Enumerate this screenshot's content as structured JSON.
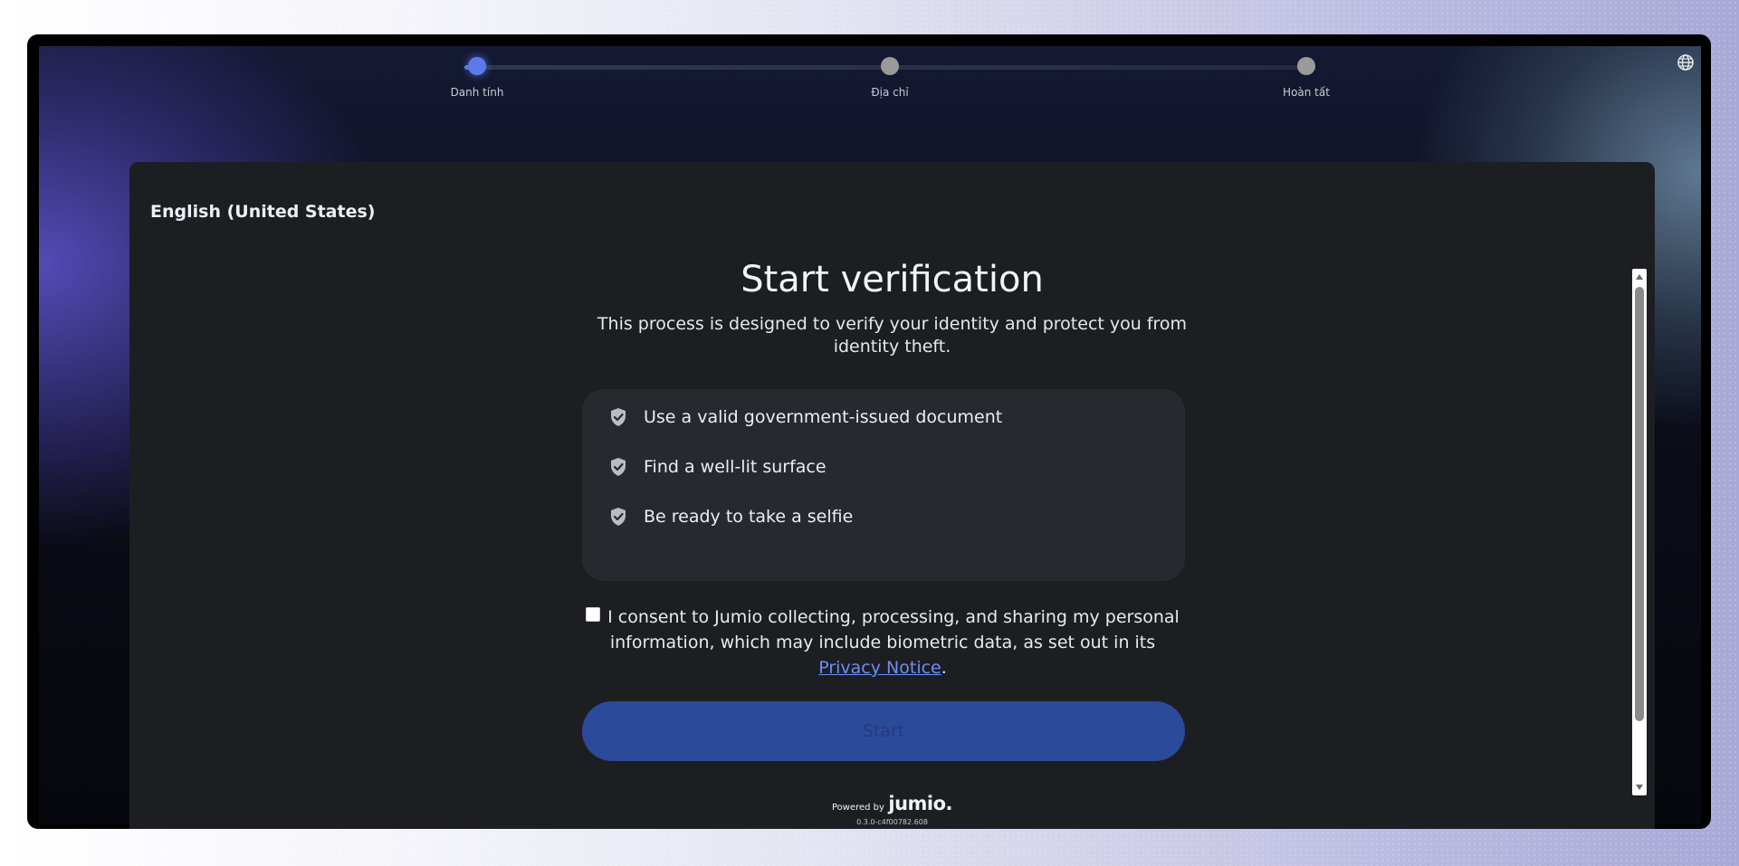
{
  "progress": {
    "steps": [
      {
        "label": "Danh tính",
        "active": true
      },
      {
        "label": "Địa chỉ",
        "active": false
      },
      {
        "label": "Hoàn tất",
        "active": false
      }
    ]
  },
  "language": {
    "selected": "English (United States)"
  },
  "main": {
    "title": "Start verification",
    "subtitle": "This process is designed to verify your identity and protect you from identity theft."
  },
  "checklist": {
    "items": [
      {
        "text": "Use a valid government-issued document",
        "icon": "shield-check-icon"
      },
      {
        "text": "Find a well-lit surface",
        "icon": "shield-check-icon"
      },
      {
        "text": "Be ready to take a selfie",
        "icon": "shield-check-icon"
      }
    ]
  },
  "consent": {
    "checked": false,
    "text": "I consent to Jumio collecting, processing, and sharing my personal information, which may include biometric data, as set out in its",
    "link_text": "Privacy Notice",
    "end": "."
  },
  "start_button": {
    "label": "Start",
    "enabled": false
  },
  "footer": {
    "powered_by": "Powered by",
    "brand": "jumio.",
    "version": "0.3.0-c4f00782.608"
  },
  "colors": {
    "accent": "#5d7be8",
    "button": "#2c4a9a",
    "card": "#1d1e22",
    "link": "#6c8ef5"
  }
}
